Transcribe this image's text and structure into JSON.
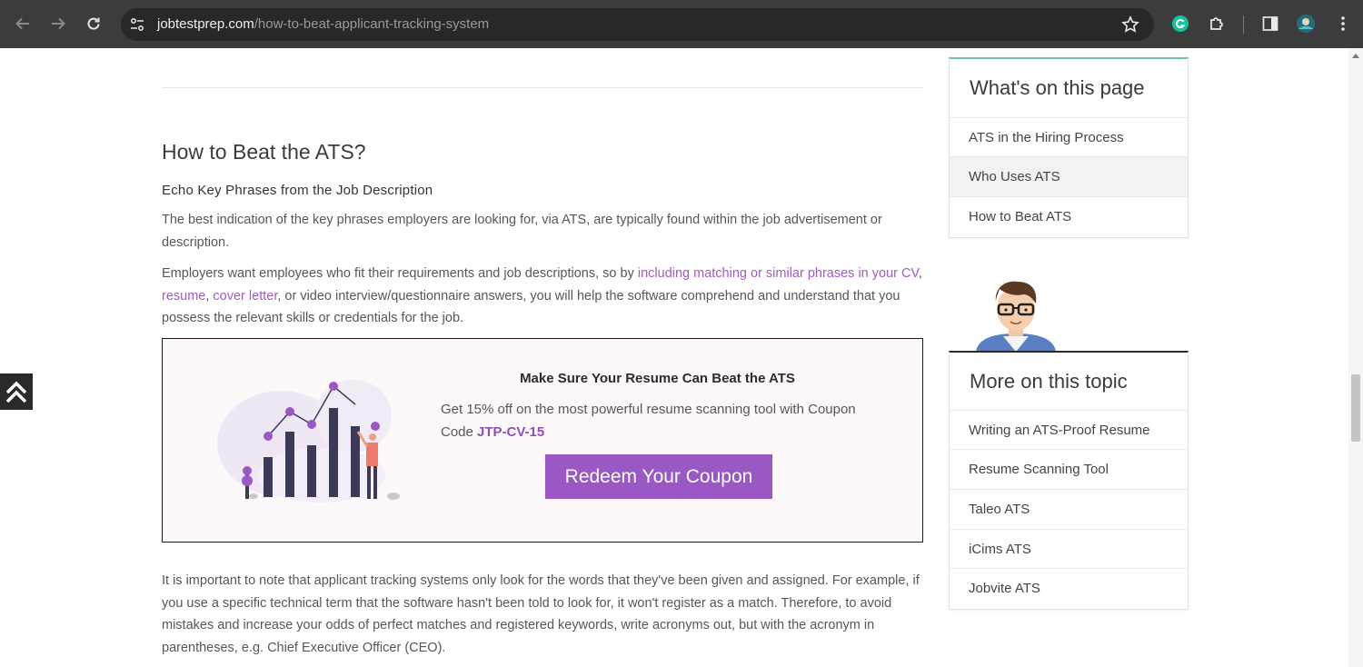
{
  "browser": {
    "url_host": "jobtestprep.com",
    "url_path": "/how-to-beat-applicant-tracking-system"
  },
  "article": {
    "section_title": "How to Beat the ATS?",
    "subheading": "Echo Key Phrases from the Job Description",
    "para1": "The best indication of the key phrases employers are looking for, via ATS, are typically found within the job advertisement or description.",
    "para2": {
      "before": "Employers want employees who fit their requirements and job descriptions, so by ",
      "link1": "including matching or similar phrases in your CV",
      "sep1": ", ",
      "link2": "resume",
      "sep2": ", ",
      "link3": "cover letter",
      "after": ", or video interview/questionnaire answers, you will help the software comprehend and understand that you possess the relevant skills or credentials for the job."
    },
    "promo": {
      "title": "Make Sure Your Resume Can Beat the ATS",
      "text": "Get 15% off on the most powerful resume scanning tool with Coupon Code ",
      "code": "JTP-CV-15",
      "button": "Redeem Your Coupon"
    },
    "para3": "It is important to note that applicant tracking systems only look for the words that they've been given and assigned. For example, if you use a specific technical term that the software hasn't been told to look for, it won't register as a match. Therefore, to avoid mistakes and increase your odds of perfect matches and registered keywords, write acronyms out, but with the acronym in parentheses, e.g. Chief Executive Officer (CEO)."
  },
  "sidebar": {
    "toc": {
      "title": "What's on this page",
      "items": [
        "ATS in the Hiring Process",
        "Who Uses ATS",
        "How to Beat ATS"
      ]
    },
    "topic": {
      "title": "More on this topic",
      "items": [
        "Writing an ATS-Proof Resume",
        "Resume Scanning Tool",
        "Taleo ATS",
        "iCims ATS",
        "Jobvite ATS"
      ]
    }
  },
  "colors": {
    "accent": "#9a58c4",
    "link": "#a25ac2",
    "toc_top_border": "#6cc5a6"
  }
}
